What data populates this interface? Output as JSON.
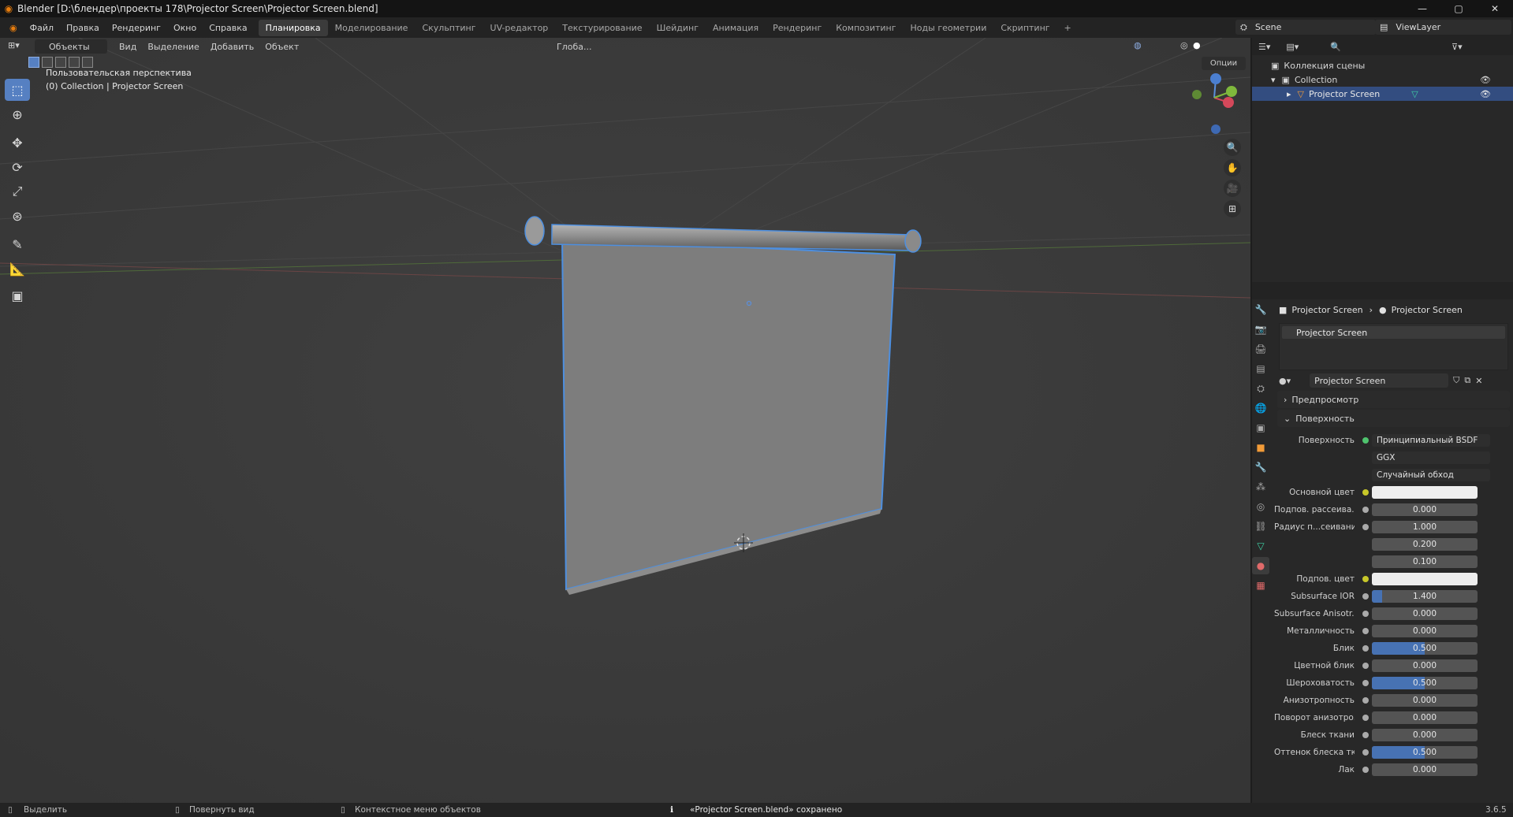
{
  "app": {
    "title": "Blender [D:\\блендер\\проекты 178\\Projector Screen\\Projector Screen.blend]",
    "win_buttons": [
      "—",
      "▢",
      "✕"
    ]
  },
  "menu": [
    "Файл",
    "Правка",
    "Рендеринг",
    "Окно",
    "Справка"
  ],
  "workspaces": [
    {
      "label": "Планировка",
      "active": true
    },
    {
      "label": "Моделирование"
    },
    {
      "label": "Скульптинг"
    },
    {
      "label": "UV-редактор"
    },
    {
      "label": "Текстурирование"
    },
    {
      "label": "Шейдинг"
    },
    {
      "label": "Анимация"
    },
    {
      "label": "Рендеринг"
    },
    {
      "label": "Композитинг"
    },
    {
      "label": "Ноды геометрии"
    },
    {
      "label": "Скриптинг"
    }
  ],
  "scene": {
    "name": "Scene",
    "view_layer": "ViewLayer"
  },
  "viewport": {
    "mode": "Объекты",
    "menus": [
      "Вид",
      "Выделение",
      "Добавить",
      "Объект"
    ],
    "transform": "Глоба...",
    "options": "Опции",
    "info_line1": "Пользовательская перспектива",
    "info_line2": "(0) Collection | Projector Screen"
  },
  "outliner": {
    "root": "Коллекция сцены",
    "collection": "Collection",
    "object": "Projector Screen"
  },
  "properties": {
    "crumb_object": "Projector Screen",
    "crumb_material": "Projector Screen",
    "slot": "Projector Screen",
    "material": "Projector Screen",
    "panel_preview": "Предпросмотр",
    "panel_surface": "Поверхность",
    "surface_label": "Поверхность",
    "surface_value": "Принципиальный BSDF",
    "distribution": "GGX",
    "subsurface_method": "Случайный обход",
    "rows": [
      {
        "label": "Основной цвет",
        "value": "",
        "color": "#eeeeee"
      },
      {
        "label": "Подпов. рассеива...",
        "value": "0.000"
      },
      {
        "label": "Радиус п...сеивания",
        "value": "1.000"
      },
      {
        "label": "",
        "value": "0.200"
      },
      {
        "label": "",
        "value": "0.100"
      },
      {
        "label": "Подпов. цвет",
        "value": "",
        "color": "#eeeeee"
      },
      {
        "label": "Subsurface IOR",
        "value": "1.400",
        "fill": 0.1
      },
      {
        "label": "Subsurface Anisotr...",
        "value": "0.000"
      },
      {
        "label": "Металличность",
        "value": "0.000"
      },
      {
        "label": "Блик",
        "value": "0.500",
        "fill": 0.5
      },
      {
        "label": "Цветной блик",
        "value": "0.000"
      },
      {
        "label": "Шероховатость",
        "value": "0.500",
        "fill": 0.5
      },
      {
        "label": "Анизотропность",
        "value": "0.000"
      },
      {
        "label": "Поворот анизотро...",
        "value": "0.000"
      },
      {
        "label": "Блеск ткани",
        "value": "0.000"
      },
      {
        "label": "Оттенок блеска тк...",
        "value": "0.500",
        "fill": 0.5
      },
      {
        "label": "Лак",
        "value": "0.000"
      }
    ]
  },
  "status": {
    "select": "Выделить",
    "rotate": "Повернуть вид",
    "context": "Контекстное меню объектов",
    "message": "«Projector Screen.blend» сохранено",
    "version": "3.6.5"
  },
  "colors": {
    "accent": "#4772b3",
    "selection_outline": "#4d8fe0",
    "background": "#3a3a3a"
  }
}
